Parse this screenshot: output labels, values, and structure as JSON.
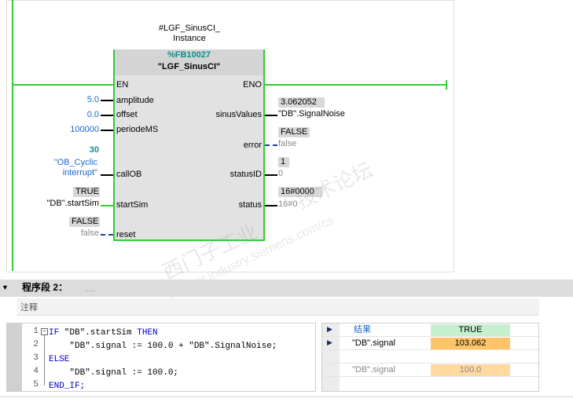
{
  "instance": {
    "line1": "#LGF_SinusCI_",
    "line2": "Instance"
  },
  "block": {
    "number": "%FB10027",
    "name": "\"LGF_SinusCI\""
  },
  "pins_left": {
    "en": "EN",
    "amplitude": "amplitude",
    "offset": "offset",
    "periode": "periodeMS",
    "callob": "callOB",
    "startsim": "startSim",
    "reset": "reset"
  },
  "pins_right": {
    "eno": "ENO",
    "sinus": "sinusValues",
    "error": "error",
    "statusid": "statusID",
    "status": "status"
  },
  "inputs": {
    "amplitude": "5.0",
    "offset": "0.0",
    "periode": "100000",
    "callob_num": "30",
    "callob_name1": "\"OB_Cyclic",
    "callob_name2": "interrupt\"",
    "startsim_val": "TRUE",
    "startsim_tag": "\"DB\".startSim",
    "reset_val": "FALSE",
    "reset_tag": "false"
  },
  "outputs": {
    "sinus_val": "3.062052",
    "sinus_tag": "\"DB\".SignalNoise",
    "error_val": "FALSE",
    "error_tag": "false",
    "statusid_val": "1",
    "statusid_tag": "0",
    "status_val": "16#0000",
    "status_tag": "16#0"
  },
  "segment": {
    "title": "程序段 2：",
    "dots": "....."
  },
  "comment_label": "注释",
  "code": {
    "lines": [
      "1",
      "2",
      "3",
      "4",
      "5"
    ],
    "l1_kw1": "IF",
    "l1_text": " \"DB\".startSim ",
    "l1_kw2": "THEN",
    "l2": "    \"DB\".signal := 100.0 + \"DB\".SignalNoise;",
    "l3": "ELSE",
    "l4": "    \"DB\".signal := 100.0;",
    "l5": "END_IF;"
  },
  "results": {
    "header_label": "结果",
    "header_value": "TRUE",
    "row1_label": "\"DB\".signal",
    "row1_value": "103.062",
    "row3_label": "\"DB\".signal",
    "row3_value": "100.0"
  },
  "watermark": {
    "text1": "西门子工业",
    "text2": "技术论坛",
    "text3": "support.industry.siemens.com/cs"
  },
  "colors": {
    "rung": "#33cc33",
    "highlight": "#ffc466",
    "result_true": "#c6efce"
  }
}
